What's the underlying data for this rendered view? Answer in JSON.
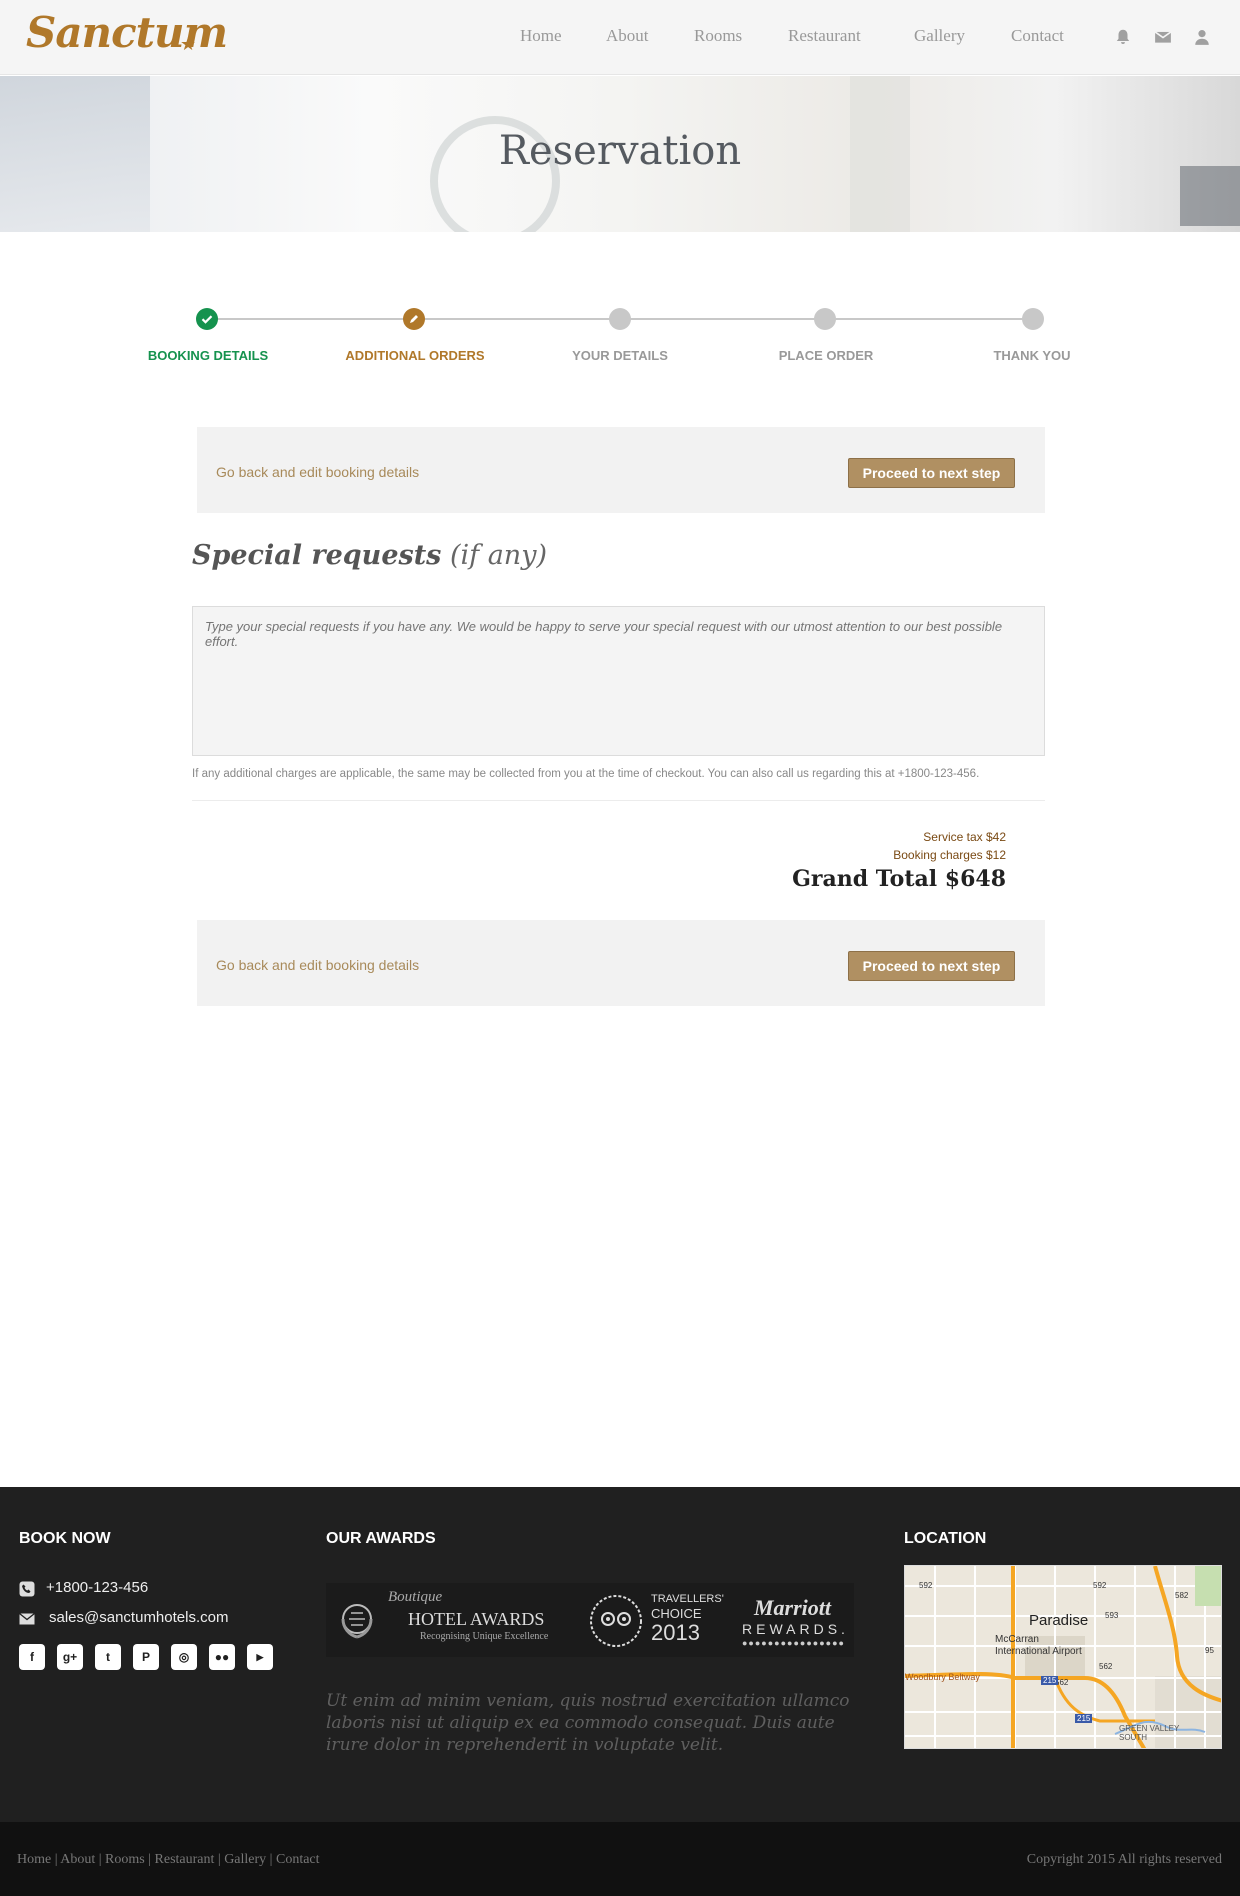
{
  "header": {
    "logo": "Sanctum",
    "nav": [
      "Home",
      "About",
      "Rooms",
      "Restaurant",
      "Gallery",
      "Contact"
    ],
    "icons": [
      "bell-icon",
      "envelope-icon",
      "user-icon"
    ]
  },
  "hero": {
    "title": "Reservation"
  },
  "steps": [
    {
      "label": "BOOKING DETAILS",
      "state": "done"
    },
    {
      "label": "ADDITIONAL ORDERS",
      "state": "active"
    },
    {
      "label": "YOUR DETAILS",
      "state": "pending"
    },
    {
      "label": "PLACE ORDER",
      "state": "pending"
    },
    {
      "label": "THANK YOU",
      "state": "pending"
    }
  ],
  "actions": {
    "back": "Go back and edit booking details",
    "next": "Proceed to next step"
  },
  "special": {
    "title_bold": "Special requests",
    "title_italic": "(if any)",
    "placeholder": "Type your special requests if you have any. We would be happy to serve your special request with our utmost attention to our best possible effort.",
    "note": "If any additional charges are applicable, the same may be collected from you at the time of checkout.  You can also call us regarding this at +1800-123-456."
  },
  "charges": {
    "service_tax": "Service tax  $42",
    "booking": "Booking charges  $12",
    "grand_total": "Grand Total $648"
  },
  "footer": {
    "book_now": "BOOK NOW",
    "phone": "+1800-123-456",
    "email": "sales@sanctumhotels.com",
    "social": [
      "facebook-icon",
      "google-plus-icon",
      "twitter-icon",
      "pinterest-icon",
      "instagram-icon",
      "flickr-icon",
      "youtube-icon"
    ],
    "awards_title": "OUR AWARDS",
    "awards": {
      "boutique_script": "Boutique",
      "boutique_name": "HOTEL AWARDS",
      "boutique_tag": "Recognising Unique Excellence",
      "tripadvisor_line1": "TRAVELLERS'",
      "tripadvisor_line2": "CHOICE",
      "tripadvisor_year": "2013",
      "marriott_name": "Marriott",
      "marriott_sub": "REWARDS."
    },
    "quote": "Ut enim ad minim veniam, quis nostrud exercitation ullamco laboris nisi ut aliquip ex ea commodo consequat. Duis aute irure dolor in reprehenderit in voluptate velit.",
    "location_title": "LOCATION",
    "map_labels": {
      "city": "Paradise",
      "airport": "McCarran International Airport",
      "road": "Woodbury Beltway",
      "area": "GREEN VALLEY SOUTH",
      "route_592a": "592",
      "route_592b": "592",
      "route_593": "593",
      "route_582": "582",
      "route_562a": "562",
      "route_562b": "562",
      "route_215a": "215",
      "route_215b": "215",
      "route_95": "95"
    },
    "bottom_links": "Home | About | Rooms | Restaurant | Gallery | Contact",
    "copyright": "Copyright 2015 All rights reserved"
  }
}
